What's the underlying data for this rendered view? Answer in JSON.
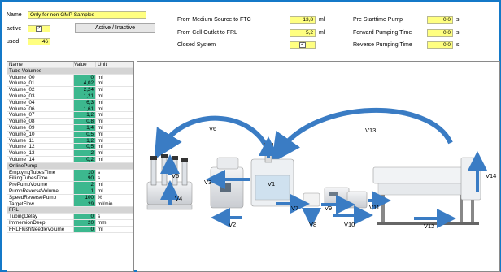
{
  "header": {
    "name_label": "Name",
    "name_value": "Only for non GMP Samples",
    "active_label": "active",
    "active_checked": "✓",
    "used_label": "used",
    "used_value": "46",
    "toggle_button": "Active / Inactive"
  },
  "settings_mid": [
    {
      "label": "From Medium Source to FTC",
      "value": "13,8",
      "unit": "ml"
    },
    {
      "label": "From Cell Outlet to FRL",
      "value": "5,2",
      "unit": "ml"
    },
    {
      "label": "Closed System",
      "value": "✓",
      "unit": ""
    }
  ],
  "settings_right": [
    {
      "label": "Pre Starttime Pump",
      "value": "0,0",
      "unit": "s"
    },
    {
      "label": "Forward Pumping Time",
      "value": "0,0",
      "unit": "s"
    },
    {
      "label": "Reverse Pumping Time",
      "value": "0,0",
      "unit": "s"
    }
  ],
  "table": {
    "columns": [
      "Name",
      "Value",
      "Unit"
    ],
    "rows": [
      {
        "type": "group",
        "name": "Tube Volumes"
      },
      {
        "name": "Volume_00",
        "value": "0",
        "unit": "ml"
      },
      {
        "name": "Volume_01",
        "value": "4,02",
        "unit": "ml"
      },
      {
        "name": "Volume_02",
        "value": "2,24",
        "unit": "ml"
      },
      {
        "name": "Volume_03",
        "value": "1,21",
        "unit": "ml"
      },
      {
        "name": "Volume_04",
        "value": "6,3",
        "unit": "ml"
      },
      {
        "name": "Volume_06",
        "value": "1,61",
        "unit": "ml"
      },
      {
        "name": "Volume_07",
        "value": "1,2",
        "unit": "ml"
      },
      {
        "name": "Volume_08",
        "value": "0,8",
        "unit": "ml"
      },
      {
        "name": "Volume_09",
        "value": "1,4",
        "unit": "ml"
      },
      {
        "name": "Volume_10",
        "value": "0,5",
        "unit": "ml"
      },
      {
        "name": "Volume_11",
        "value": "1,2",
        "unit": "ml"
      },
      {
        "name": "Volume_12",
        "value": "0,5",
        "unit": "ml"
      },
      {
        "name": "Volume_13",
        "value": "2",
        "unit": "ml"
      },
      {
        "name": "Volume_14",
        "value": "0,2",
        "unit": "ml"
      },
      {
        "type": "group",
        "name": "OnlinePump"
      },
      {
        "name": "EmptyingTubesTime",
        "value": "10",
        "unit": "s"
      },
      {
        "name": "FillingTubesTime",
        "value": "90",
        "unit": "s"
      },
      {
        "name": "PrePumpVolume",
        "value": "2",
        "unit": "ml"
      },
      {
        "name": "PumpReverseVolume",
        "value": "1",
        "unit": "ml"
      },
      {
        "name": "SpeedReversePump",
        "value": "100",
        "unit": "%"
      },
      {
        "name": "TargetFlow",
        "value": "29",
        "unit": "ml/min"
      },
      {
        "type": "group",
        "name": "FRL"
      },
      {
        "name": "TubingDelay",
        "value": "0",
        "unit": "s"
      },
      {
        "name": "ImmersionDeep",
        "value": "20",
        "unit": "mm"
      },
      {
        "name": "FRLFlushNeedleVolume",
        "value": "0",
        "unit": "ml"
      }
    ]
  },
  "diagram": {
    "labels": [
      "V1",
      "V2",
      "V3",
      "V4",
      "V5",
      "V6",
      "V7",
      "V8",
      "V9",
      "V10",
      "V11",
      "V12",
      "V13",
      "V14"
    ],
    "arrow_color": "#3a7cc4"
  }
}
